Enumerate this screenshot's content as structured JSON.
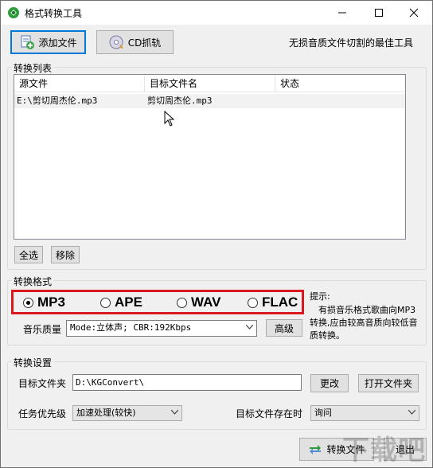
{
  "window": {
    "title": "格式转换工具",
    "slogan": "无损音质文件切割的最佳工具"
  },
  "toolbar": {
    "add_file_label": "添加文件",
    "cd_rip_label": "CD抓轨"
  },
  "convert_list": {
    "group_label": "转换列表",
    "columns": [
      "源文件",
      "目标文件名",
      "状态"
    ],
    "rows": [
      {
        "source": "E:\\剪切周杰伦.mp3",
        "target": "剪切周杰伦.mp3",
        "status": ""
      }
    ],
    "select_all_label": "全选",
    "remove_label": "移除"
  },
  "format": {
    "group_label": "转换格式",
    "options": [
      "MP3",
      "APE",
      "WAV",
      "FLAC"
    ],
    "selected": "MP3",
    "quality_label": "音乐质量",
    "quality_value": "Mode:立体声; CBR:192Kbps",
    "advanced_label": "高级",
    "hint_title": "提示:",
    "hint_text": "有损音乐格式歌曲向MP3转换,应由较高音质向较低音质转换。"
  },
  "settings": {
    "group_label": "转换设置",
    "target_folder_label": "目标文件夹",
    "target_folder_value": "D:\\KGConvert\\",
    "change_label": "更改",
    "open_folder_label": "打开文件夹",
    "priority_label": "任务优先级",
    "priority_value": "加速处理(较快)",
    "exists_label": "目标文件存在时",
    "exists_value": "询问"
  },
  "footer": {
    "convert_label": "转换文件",
    "exit_label": "退出",
    "watermark": "下载吧"
  },
  "colors": {
    "highlight_border": "#d9181f",
    "focus_border": "#0078d7"
  }
}
